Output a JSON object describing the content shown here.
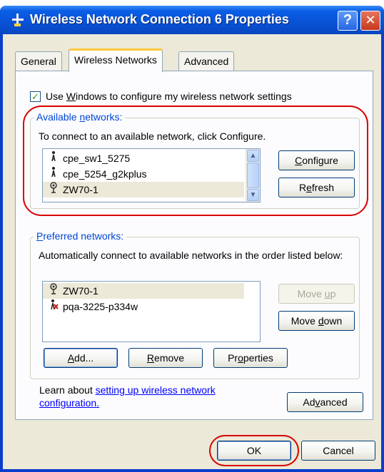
{
  "window": {
    "title": "Wireless Network Connection 6 Properties",
    "help_glyph": "?",
    "close_glyph": "✕"
  },
  "tabs": [
    {
      "label": "General"
    },
    {
      "label": "Wireless Networks"
    },
    {
      "label": "Advanced"
    }
  ],
  "use_windows": {
    "checked": true,
    "pre": "Use ",
    "key": "W",
    "post": "indows to configure my wireless network settings"
  },
  "available": {
    "legend_pre": "Available ",
    "legend_key": "n",
    "legend_post": "etworks:",
    "description": "To connect to an available network, click Configure.",
    "networks": [
      {
        "name": "cpe_sw1_5275",
        "icon": "ad-hoc-network-icon",
        "selected": false
      },
      {
        "name": "cpe_5254_g2kplus",
        "icon": "ad-hoc-network-icon",
        "selected": false
      },
      {
        "name": "ZW70-1",
        "icon": "access-point-icon",
        "selected": true
      }
    ],
    "configure_key": "C",
    "configure_rest": "onfigure",
    "refresh_pre": "R",
    "refresh_key": "e",
    "refresh_post": "fresh"
  },
  "preferred": {
    "legend_key": "P",
    "legend_post": "referred networks:",
    "description": "Automatically connect to available networks in the order listed below:",
    "networks": [
      {
        "name": "ZW70-1",
        "icon": "access-point-icon",
        "selected": true
      },
      {
        "name": "pqa-3225-p334w",
        "icon": "unavailable-network-icon",
        "selected": false
      }
    ],
    "move_up_pre": "Move ",
    "move_up_key": "u",
    "move_up_post": "p",
    "move_down_pre": "Move ",
    "move_down_key": "d",
    "move_down_post": "own",
    "add_key": "A",
    "add_post": "dd...",
    "remove_key": "R",
    "remove_post": "emove",
    "properties_pre": "Pr",
    "properties_key": "o",
    "properties_post": "perties"
  },
  "learn": {
    "text_pre": "Learn about ",
    "link_text_1": "setting up wireless network",
    "link_text_2": "configuration.",
    "advanced_pre": "Ad",
    "advanced_key": "v",
    "advanced_post": "anced"
  },
  "footer": {
    "ok_label": "OK",
    "cancel_label": "Cancel"
  },
  "colors": {
    "title_bar": "#0852d6",
    "highlight_ring": "#d80000",
    "link": "#0000ff",
    "legend": "#0046d5"
  }
}
